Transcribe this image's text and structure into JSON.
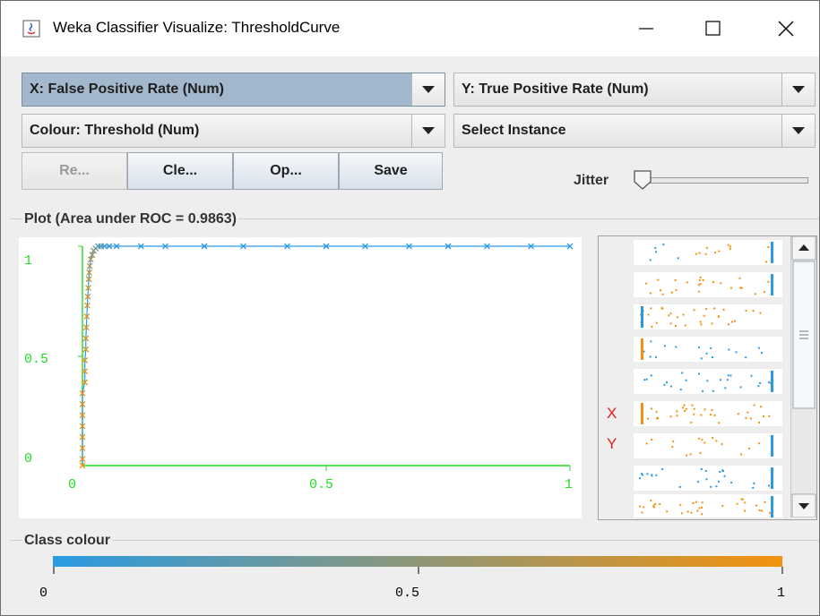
{
  "window": {
    "title": "Weka Classifier Visualize: ThresholdCurve"
  },
  "controls": {
    "x_axis": "X: False Positive Rate (Num)",
    "y_axis": "Y: True Positive Rate (Num)",
    "colour": "Colour: Threshold (Num)",
    "instance": "Select Instance",
    "buttons": [
      "Re...",
      "Cle...",
      "Op...",
      "Save"
    ],
    "jitter_label": "Jitter",
    "jitter_value": 0
  },
  "plot": {
    "title": "Plot (Area under ROC = 0.9863)",
    "x_ticks": [
      "0",
      "0.5",
      "1"
    ],
    "y_ticks": [
      "1",
      "0.5",
      "0"
    ]
  },
  "attribute_panel": {
    "x_marker": "X",
    "y_marker": "Y"
  },
  "class_colour": {
    "title": "Class colour",
    "ticks": [
      "0",
      "0.5",
      "1"
    ],
    "start": "#2a9be3",
    "end": "#f2920d"
  },
  "colors": {
    "low": "#2a9be3",
    "high": "#f2920d",
    "axis": "#22dd22",
    "selected": "#a3b8cc"
  },
  "chart_data": {
    "type": "scatter",
    "title": "Plot (Area under ROC = 0.9863)",
    "x_axis_label": "False Positive Rate",
    "y_axis_label": "True Positive Rate",
    "xlim": [
      0,
      1
    ],
    "ylim": [
      0,
      1
    ],
    "x_ticks": [
      0,
      0.5,
      1
    ],
    "y_ticks": [
      0,
      0.5,
      1
    ],
    "colour_by": "Threshold",
    "points": [
      {
        "x": 0.0,
        "y": 0.0,
        "t": 1.0
      },
      {
        "x": 0.0,
        "y": 0.03,
        "t": 0.99
      },
      {
        "x": 0.0,
        "y": 0.08,
        "t": 0.98
      },
      {
        "x": 0.0,
        "y": 0.13,
        "t": 0.98
      },
      {
        "x": 0.0,
        "y": 0.18,
        "t": 0.97
      },
      {
        "x": 0.0,
        "y": 0.23,
        "t": 0.97
      },
      {
        "x": 0.0,
        "y": 0.28,
        "t": 0.96
      },
      {
        "x": 0.0,
        "y": 0.33,
        "t": 0.96
      },
      {
        "x": 0.005,
        "y": 0.38,
        "t": 0.95
      },
      {
        "x": 0.005,
        "y": 0.43,
        "t": 0.94
      },
      {
        "x": 0.005,
        "y": 0.48,
        "t": 0.93
      },
      {
        "x": 0.007,
        "y": 0.53,
        "t": 0.92
      },
      {
        "x": 0.007,
        "y": 0.58,
        "t": 0.91
      },
      {
        "x": 0.008,
        "y": 0.63,
        "t": 0.9
      },
      {
        "x": 0.009,
        "y": 0.68,
        "t": 0.88
      },
      {
        "x": 0.01,
        "y": 0.73,
        "t": 0.86
      },
      {
        "x": 0.011,
        "y": 0.77,
        "t": 0.84
      },
      {
        "x": 0.012,
        "y": 0.81,
        "t": 0.82
      },
      {
        "x": 0.013,
        "y": 0.85,
        "t": 0.8
      },
      {
        "x": 0.014,
        "y": 0.88,
        "t": 0.77
      },
      {
        "x": 0.015,
        "y": 0.91,
        "t": 0.73
      },
      {
        "x": 0.017,
        "y": 0.94,
        "t": 0.68
      },
      {
        "x": 0.02,
        "y": 0.96,
        "t": 0.6
      },
      {
        "x": 0.023,
        "y": 0.98,
        "t": 0.5
      },
      {
        "x": 0.027,
        "y": 0.99,
        "t": 0.4
      },
      {
        "x": 0.032,
        "y": 1.0,
        "t": 0.3
      },
      {
        "x": 0.038,
        "y": 1.0,
        "t": 0.2
      },
      {
        "x": 0.045,
        "y": 1.0,
        "t": 0.12
      },
      {
        "x": 0.055,
        "y": 1.0,
        "t": 0.06
      },
      {
        "x": 0.07,
        "y": 1.0,
        "t": 0.03
      },
      {
        "x": 0.12,
        "y": 1.0,
        "t": 0.01
      },
      {
        "x": 0.17,
        "y": 1.0,
        "t": 0.01
      },
      {
        "x": 0.25,
        "y": 1.0,
        "t": 0.0
      },
      {
        "x": 0.33,
        "y": 1.0,
        "t": 0.0
      },
      {
        "x": 0.42,
        "y": 1.0,
        "t": 0.0
      },
      {
        "x": 0.5,
        "y": 1.0,
        "t": 0.0
      },
      {
        "x": 0.58,
        "y": 1.0,
        "t": 0.0
      },
      {
        "x": 0.67,
        "y": 1.0,
        "t": 0.0
      },
      {
        "x": 0.75,
        "y": 1.0,
        "t": 0.0
      },
      {
        "x": 0.83,
        "y": 1.0,
        "t": 0.0
      },
      {
        "x": 0.92,
        "y": 1.0,
        "t": 0.0
      },
      {
        "x": 1.0,
        "y": 1.0,
        "t": 0.0
      }
    ],
    "grid": false,
    "legend": "none"
  }
}
